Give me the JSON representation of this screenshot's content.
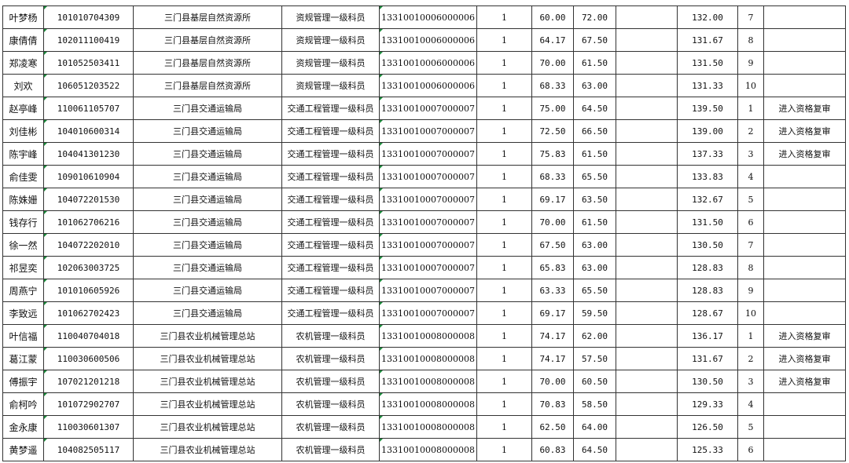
{
  "rows": [
    {
      "name": "叶梦杨",
      "id": "101010704309",
      "org": "三门县基层自然资源所",
      "post": "资规管理一级科员",
      "code": "13310010006000006",
      "quota": "1",
      "s1": "60.00",
      "s2": "72.00",
      "extra": "",
      "total": "132.00",
      "rank": "7",
      "note": ""
    },
    {
      "name": "康倩倩",
      "id": "102011100419",
      "org": "三门县基层自然资源所",
      "post": "资规管理一级科员",
      "code": "13310010006000006",
      "quota": "1",
      "s1": "64.17",
      "s2": "67.50",
      "extra": "",
      "total": "131.67",
      "rank": "8",
      "note": ""
    },
    {
      "name": "郑凌寒",
      "id": "101052503411",
      "org": "三门县基层自然资源所",
      "post": "资规管理一级科员",
      "code": "13310010006000006",
      "quota": "1",
      "s1": "70.00",
      "s2": "61.50",
      "extra": "",
      "total": "131.50",
      "rank": "9",
      "note": ""
    },
    {
      "name": "刘欢",
      "id": "106051203522",
      "org": "三门县基层自然资源所",
      "post": "资规管理一级科员",
      "code": "13310010006000006",
      "quota": "1",
      "s1": "68.33",
      "s2": "63.00",
      "extra": "",
      "total": "131.33",
      "rank": "10",
      "note": ""
    },
    {
      "name": "赵亭峰",
      "id": "110061105707",
      "org": "三门县交通运输局",
      "post": "交通工程管理一级科员",
      "code": "13310010007000007",
      "quota": "1",
      "s1": "75.00",
      "s2": "64.50",
      "extra": "",
      "total": "139.50",
      "rank": "1",
      "note": "进入资格复审"
    },
    {
      "name": "刘佳彬",
      "id": "104010600314",
      "org": "三门县交通运输局",
      "post": "交通工程管理一级科员",
      "code": "13310010007000007",
      "quota": "1",
      "s1": "72.50",
      "s2": "66.50",
      "extra": "",
      "total": "139.00",
      "rank": "2",
      "note": "进入资格复审"
    },
    {
      "name": "陈宇峰",
      "id": "104041301230",
      "org": "三门县交通运输局",
      "post": "交通工程管理一级科员",
      "code": "13310010007000007",
      "quota": "1",
      "s1": "75.83",
      "s2": "61.50",
      "extra": "",
      "total": "137.33",
      "rank": "3",
      "note": "进入资格复审"
    },
    {
      "name": "俞佳雯",
      "id": "109010610904",
      "org": "三门县交通运输局",
      "post": "交通工程管理一级科员",
      "code": "13310010007000007",
      "quota": "1",
      "s1": "68.33",
      "s2": "65.50",
      "extra": "",
      "total": "133.83",
      "rank": "4",
      "note": ""
    },
    {
      "name": "陈姝姗",
      "id": "104072201530",
      "org": "三门县交通运输局",
      "post": "交通工程管理一级科员",
      "code": "13310010007000007",
      "quota": "1",
      "s1": "69.17",
      "s2": "63.50",
      "extra": "",
      "total": "132.67",
      "rank": "5",
      "note": ""
    },
    {
      "name": "钱存行",
      "id": "101062706216",
      "org": "三门县交通运输局",
      "post": "交通工程管理一级科员",
      "code": "13310010007000007",
      "quota": "1",
      "s1": "70.00",
      "s2": "61.50",
      "extra": "",
      "total": "131.50",
      "rank": "6",
      "note": ""
    },
    {
      "name": "徐一然",
      "id": "104072202010",
      "org": "三门县交通运输局",
      "post": "交通工程管理一级科员",
      "code": "13310010007000007",
      "quota": "1",
      "s1": "67.50",
      "s2": "63.00",
      "extra": "",
      "total": "130.50",
      "rank": "7",
      "note": ""
    },
    {
      "name": "祁昱奕",
      "id": "102063003725",
      "org": "三门县交通运输局",
      "post": "交通工程管理一级科员",
      "code": "13310010007000007",
      "quota": "1",
      "s1": "65.83",
      "s2": "63.00",
      "extra": "",
      "total": "128.83",
      "rank": "8",
      "note": ""
    },
    {
      "name": "周燕宁",
      "id": "101010605926",
      "org": "三门县交通运输局",
      "post": "交通工程管理一级科员",
      "code": "13310010007000007",
      "quota": "1",
      "s1": "63.33",
      "s2": "65.50",
      "extra": "",
      "total": "128.83",
      "rank": "9",
      "note": ""
    },
    {
      "name": "李致远",
      "id": "101062702423",
      "org": "三门县交通运输局",
      "post": "交通工程管理一级科员",
      "code": "13310010007000007",
      "quota": "1",
      "s1": "69.17",
      "s2": "59.50",
      "extra": "",
      "total": "128.67",
      "rank": "10",
      "note": ""
    },
    {
      "name": "叶信福",
      "id": "110040704018",
      "org": "三门县农业机械管理总站",
      "post": "农机管理一级科员",
      "code": "13310010008000008",
      "quota": "1",
      "s1": "74.17",
      "s2": "62.00",
      "extra": "",
      "total": "136.17",
      "rank": "1",
      "note": "进入资格复审"
    },
    {
      "name": "葛江蒙",
      "id": "110030600506",
      "org": "三门县农业机械管理总站",
      "post": "农机管理一级科员",
      "code": "13310010008000008",
      "quota": "1",
      "s1": "74.17",
      "s2": "57.50",
      "extra": "",
      "total": "131.67",
      "rank": "2",
      "note": "进入资格复审"
    },
    {
      "name": "傅振宇",
      "id": "107021201218",
      "org": "三门县农业机械管理总站",
      "post": "农机管理一级科员",
      "code": "13310010008000008",
      "quota": "1",
      "s1": "70.00",
      "s2": "60.50",
      "extra": "",
      "total": "130.50",
      "rank": "3",
      "note": "进入资格复审"
    },
    {
      "name": "俞柯吟",
      "id": "101072902707",
      "org": "三门县农业机械管理总站",
      "post": "农机管理一级科员",
      "code": "13310010008000008",
      "quota": "1",
      "s1": "70.83",
      "s2": "58.50",
      "extra": "",
      "total": "129.33",
      "rank": "4",
      "note": ""
    },
    {
      "name": "金永康",
      "id": "110030601307",
      "org": "三门县农业机械管理总站",
      "post": "农机管理一级科员",
      "code": "13310010008000008",
      "quota": "1",
      "s1": "62.50",
      "s2": "64.00",
      "extra": "",
      "total": "126.50",
      "rank": "5",
      "note": ""
    },
    {
      "name": "黄梦遥",
      "id": "104082505117",
      "org": "三门县农业机械管理总站",
      "post": "农机管理一级科员",
      "code": "13310010008000008",
      "quota": "1",
      "s1": "60.83",
      "s2": "64.50",
      "extra": "",
      "total": "125.33",
      "rank": "6",
      "note": ""
    }
  ],
  "colors": {
    "grid": "#333333",
    "flag": "#1a8a3a"
  }
}
